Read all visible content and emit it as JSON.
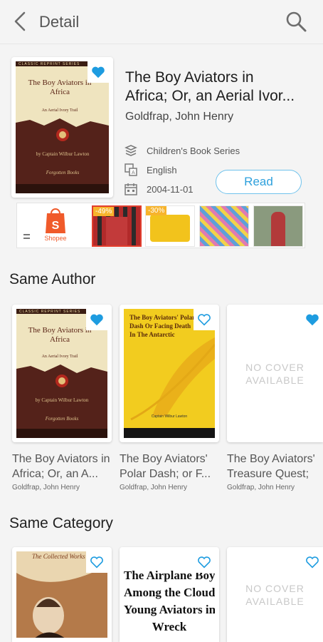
{
  "header": {
    "title": "Detail"
  },
  "book": {
    "title_line1": "The Boy Aviators in",
    "title_line2": "Africa; Or, an Aerial Ivor...",
    "authors": "Goldfrap,  John Henry",
    "series": "Children's Book Series",
    "language": "English",
    "date": "2004-11-01",
    "read_label": "Read",
    "cover_publisher": "CLASSIC REPRINT SERIES",
    "cover_title": "The Boy Aviators in Africa",
    "cover_subtitle": "An Aerial Ivory Trail",
    "cover_author": "by Captain Wilbur Lawton",
    "cover_imprint": "Forgotten Books"
  },
  "ads": {
    "shopee_label": "Shopee",
    "badge1": "-49%",
    "badge2": "-30%"
  },
  "same_author": {
    "title": "Same Author",
    "books": [
      {
        "title_line1": "The Boy Aviators in Africa; Or, an A...",
        "authors": "Goldfrap,  John Henry"
      },
      {
        "title_line1": "The Boy Aviators' Polar Dash;  or F...",
        "authors": "Goldfrap,  John Henry",
        "cover_title": "The Boy Aviators' Polar Dash Or Facing Death In The Antarctic",
        "cover_author": "Captain Wilbur Lawton"
      },
      {
        "title_line1": "The Boy Aviators' Treasure Quest;",
        "authors": "Goldfrap,  John Henry"
      }
    ]
  },
  "same_category": {
    "title": "Same Category",
    "books": [
      {
        "cover_text": "The Collected Works of"
      },
      {
        "cover_text_1": "The Airplane Boy",
        "cover_text_2": "Among the Clouds",
        "cover_text_3": "Young Aviators in",
        "cover_text_4": "Wreck"
      },
      {}
    ]
  },
  "no_cover_text_1": "NO COVER",
  "no_cover_text_2": "AVAILABLE",
  "colors": {
    "accent": "#2ea0dc",
    "heart_filled": "#1e9ce0"
  }
}
